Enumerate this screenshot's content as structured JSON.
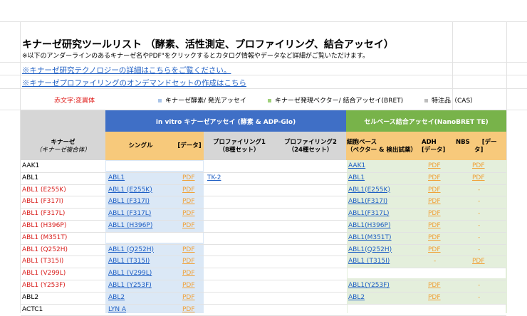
{
  "title": "キナーゼ研究ツールリスト （酵素、活性測定、プロファイリング、結合アッセイ）",
  "note": "※以下のアンダーラインのあるキナーゼ名やPDF\"をクリックするとカタログ情報やデータなど詳細がご覧いただけます。",
  "links": [
    "※キナーゼ研究テクノロジーの詳細はこちらをご覧ください。",
    "※キナーゼプロファイリングのオンデマンドセットの作成はこちら"
  ],
  "legend": {
    "red_text": "赤文字:変異体",
    "items": [
      {
        "label": "キナーゼ酵素/ 発光アッセイ",
        "color": "#a9c4e8"
      },
      {
        "label": "キナーゼ発現ベクター/ 結合アッセイ(BRET)",
        "color": "#9fd07a"
      },
      {
        "label": "特注品（CAS）",
        "color": "#bdbdbd"
      }
    ]
  },
  "headers": {
    "group_invitro": "in vitro キナーゼアッセイ (酵素 & ADP-Glo)",
    "group_cell": "セルベース結合アッセイ(NanoBRET TE)",
    "kinase": "キナーゼ",
    "kinase_sub": "（キナーゼ複合体）",
    "single": "シングル",
    "data1": "[データ]",
    "profiling1": "プロファイリング1",
    "profiling1_sub": "（8種セット）",
    "profiling2": "プロファイリング2",
    "profiling2_sub": "（24種セット）",
    "cell_based": "細胞ベース",
    "cell_based_sub": "（ベクター & 検出試薬）",
    "adh": "ADH",
    "adh_sub": "[データ]",
    "nbs": "NBS　　[デー",
    "nbs_sub": "タ]"
  },
  "rows": [
    {
      "kinase": "AAK1",
      "mutant": false,
      "single": "",
      "data": "",
      "prof1": "",
      "cell": "AAK1",
      "adh": "PDF",
      "nbs": "PDF"
    },
    {
      "kinase": "ABL1",
      "mutant": false,
      "single": "ABL1",
      "data": "PDF",
      "prof1": "TK-2",
      "cell": "ABL1",
      "adh": "PDF",
      "nbs": "PDF"
    },
    {
      "kinase": "ABL1 (E255K)",
      "mutant": true,
      "single": "ABL1 (E255K)",
      "data": "PDF",
      "prof1": "",
      "cell": "ABL1(E255K)",
      "adh": "PDF",
      "nbs": "-"
    },
    {
      "kinase": "ABL1 (F317I)",
      "mutant": true,
      "single": "ABL1 (F317I)",
      "data": "PDF",
      "prof1": "",
      "cell": "ABL1(F317I)",
      "adh": "PDF",
      "nbs": "-"
    },
    {
      "kinase": "ABL1 (F317L)",
      "mutant": true,
      "single": "ABL1 (F317L)",
      "data": "PDF",
      "prof1": "",
      "cell": "ABL1(F317L)",
      "adh": "PDF",
      "nbs": "-"
    },
    {
      "kinase": "ABL1 (H396P)",
      "mutant": true,
      "single": "ABL1 (H396P)",
      "data": "PDF",
      "prof1": "",
      "cell": "ABL1(H396P)",
      "adh": "PDF",
      "nbs": "-"
    },
    {
      "kinase": "ABL1 (M351T)",
      "mutant": true,
      "single": "",
      "data": "",
      "prof1": "",
      "cell": "ABL1(M351T)",
      "adh": "PDF",
      "nbs": "-"
    },
    {
      "kinase": "ABL1 (Q252H)",
      "mutant": true,
      "single": "ABL1 (Q252H)",
      "data": "PDF",
      "prof1": "",
      "cell": "ABL1(Q252H)",
      "adh": "PDF",
      "nbs": "-"
    },
    {
      "kinase": "ABL1 (T315I)",
      "mutant": true,
      "single": "ABL1 (T315I)",
      "data": "PDF",
      "prof1": "",
      "cell": "ABL1 (T315I)",
      "adh": "-",
      "nbs": "PDF"
    },
    {
      "kinase": "ABL1 (V299L)",
      "mutant": true,
      "single": "ABL1 (V299L)",
      "data": "PDF",
      "prof1": "",
      "cell": "",
      "adh": "",
      "nbs": ""
    },
    {
      "kinase": "ABL1 (Y253F)",
      "mutant": true,
      "single": "ABL1 (Y253F)",
      "data": "PDF",
      "prof1": "",
      "cell": "ABL1(Y253F)",
      "adh": "PDF",
      "nbs": "-"
    },
    {
      "kinase": "ABL2",
      "mutant": false,
      "single": "ABL2",
      "data": "PDF",
      "prof1": "",
      "cell": "ABL2",
      "adh": "PDF",
      "nbs": "-"
    },
    {
      "kinase": "ACTC1",
      "mutant": false,
      "single": "LYN A",
      "data": "PDF",
      "prof1": "",
      "cell": "",
      "adh": "",
      "nbs": ""
    }
  ]
}
